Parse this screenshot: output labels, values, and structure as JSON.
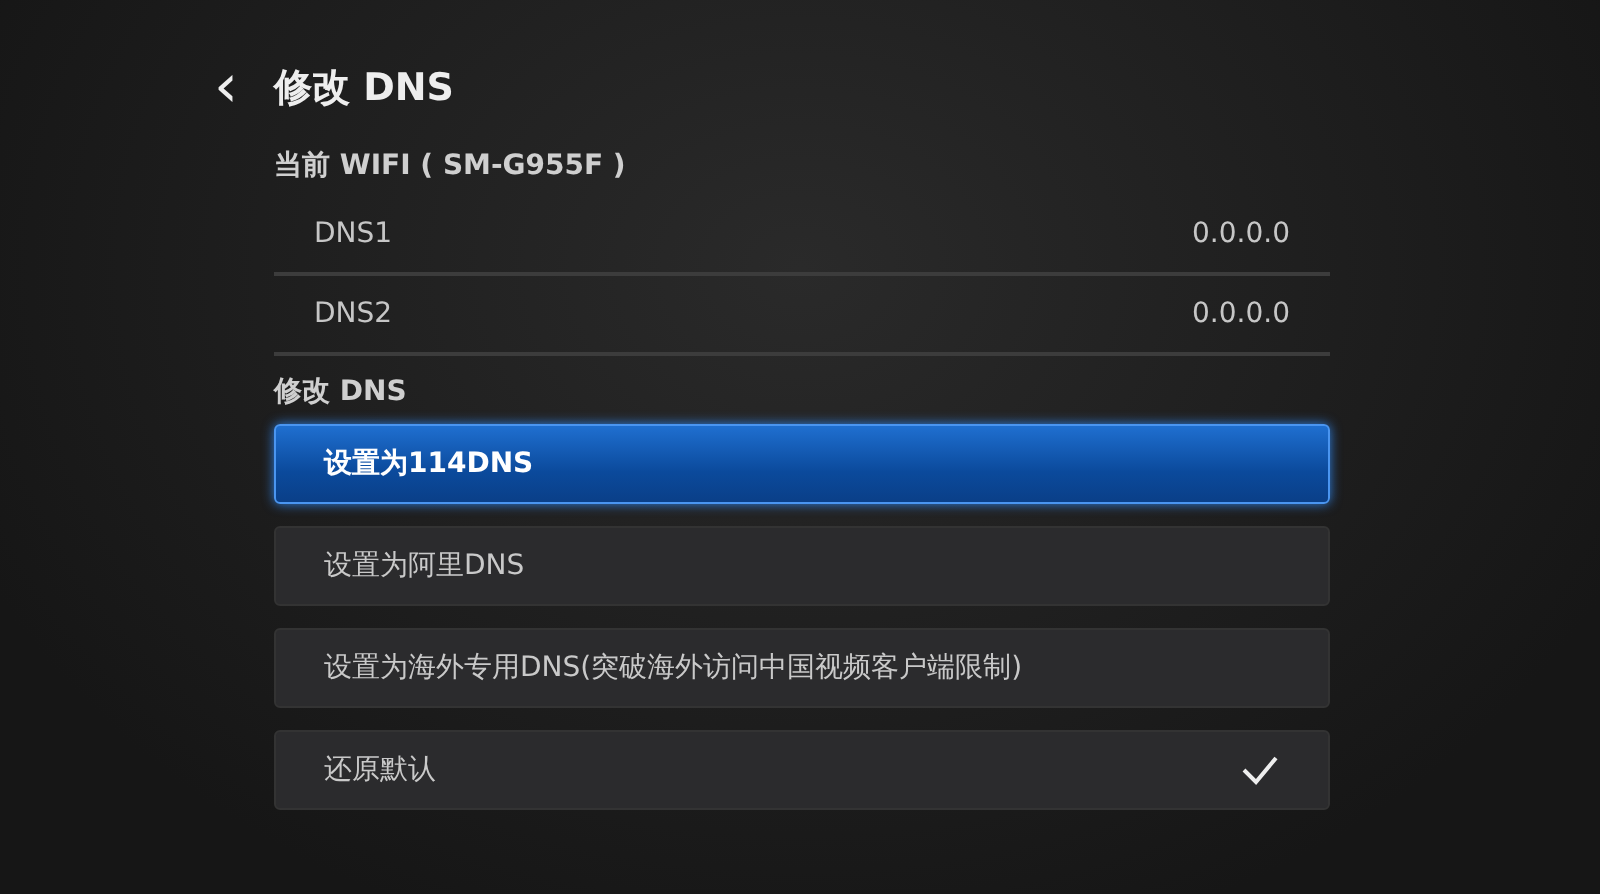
{
  "header": {
    "back_icon": "‹",
    "title": "修改 DNS"
  },
  "current_section": {
    "title": "当前 WIFI ( SM-G955F )"
  },
  "dns_rows": [
    {
      "label": "DNS1",
      "value": "0.0.0.0"
    },
    {
      "label": "DNS2",
      "value": "0.0.0.0"
    }
  ],
  "modify_section": {
    "title": "修改 DNS"
  },
  "options": [
    {
      "label": "设置为114DNS",
      "focused": true,
      "checked": false
    },
    {
      "label": "设置为阿里DNS",
      "focused": false,
      "checked": false
    },
    {
      "label": "设置为海外专用DNS(突破海外访问中国视频客户端限制)",
      "focused": false,
      "checked": false
    },
    {
      "label": "还原默认",
      "focused": false,
      "checked": true
    }
  ]
}
